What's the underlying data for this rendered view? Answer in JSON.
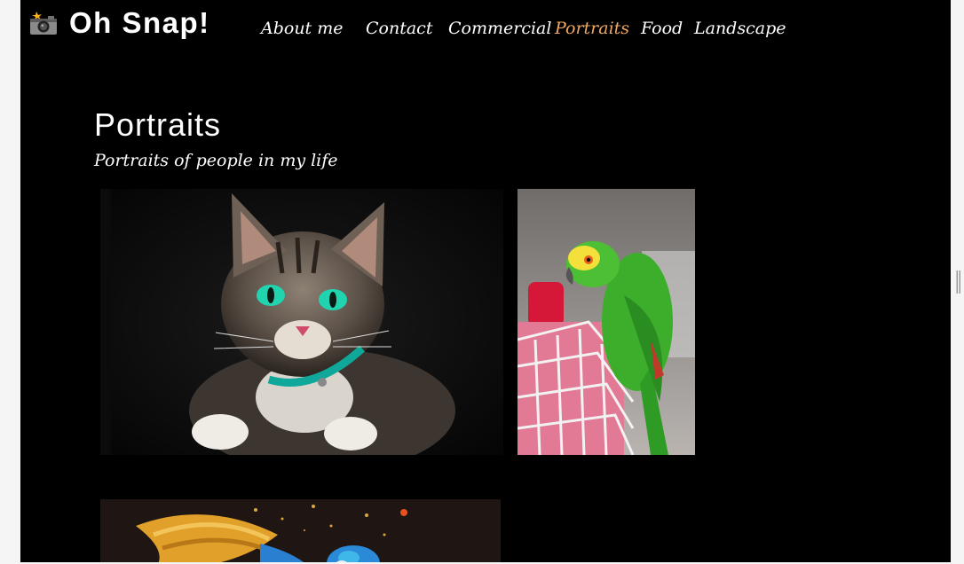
{
  "header": {
    "logo_icon": "camera-flash-icon",
    "brand": "Oh Snap!"
  },
  "nav": {
    "items": [
      {
        "label": "About me",
        "active": false
      },
      {
        "label": "Contact",
        "active": false
      },
      {
        "label": "Commercial",
        "active": false
      },
      {
        "label": "Portraits",
        "active": true
      },
      {
        "label": "Food",
        "active": false
      },
      {
        "label": "Landscape",
        "active": false
      }
    ]
  },
  "main": {
    "title": "Portraits",
    "subtitle": "Portraits of people in my life"
  },
  "gallery": {
    "photos": [
      {
        "subject": "tabby cat with green eyes"
      },
      {
        "subject": "green parrot on white cage"
      },
      {
        "subject": "blue-and-gold macaw in flight"
      }
    ]
  },
  "colors": {
    "background": "#000000",
    "text": "#ffffff",
    "active_nav": "#f0a860"
  }
}
